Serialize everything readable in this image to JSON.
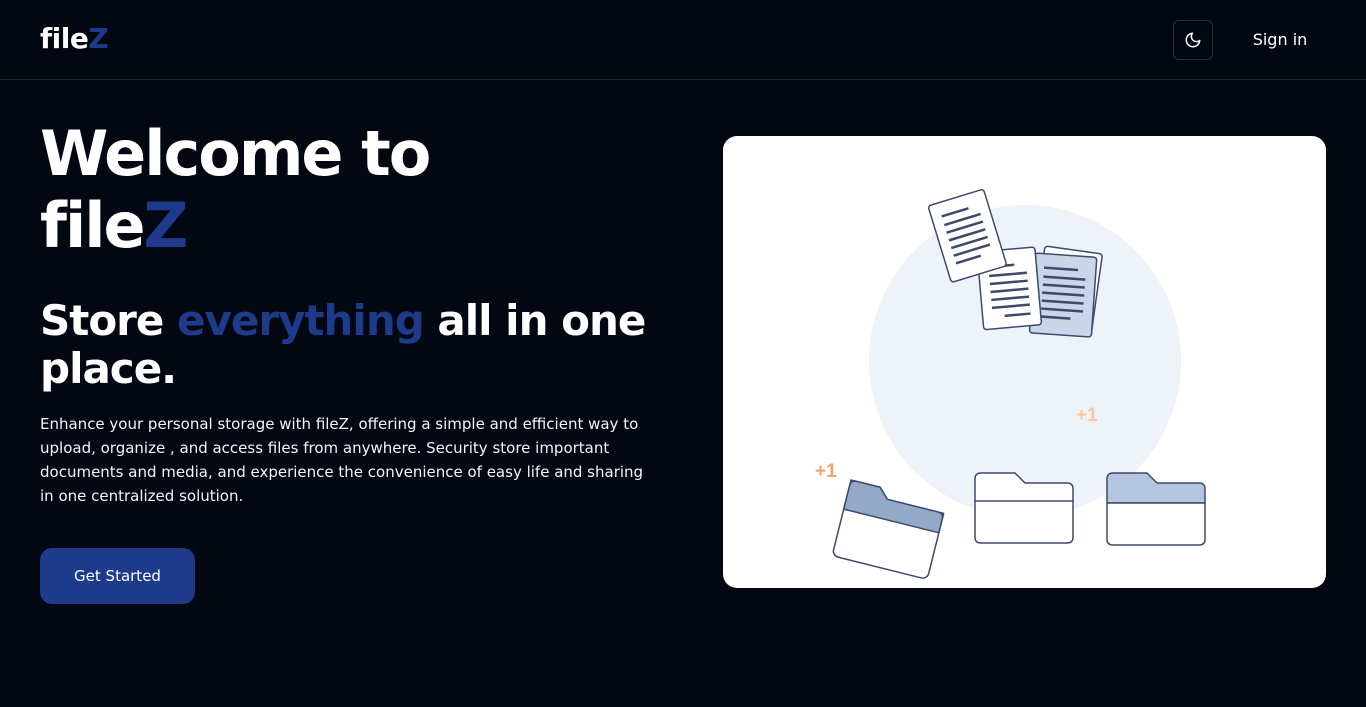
{
  "navbar": {
    "logo_main": "file",
    "logo_accent": "Z",
    "theme_toggle_icon": "moon-icon",
    "signin_label": "Sign in"
  },
  "hero": {
    "title_line1": "Welcome to",
    "title_main": "file",
    "title_accent": "Z",
    "subtitle_part1": "Store ",
    "subtitle_highlight": "everything",
    "subtitle_part2": " all in one place.",
    "description": "Enhance your personal storage with fileZ, offering a simple and efficient way to upload, organize , and access files from anywhere. Security store important documents and media, and experience the convenience of easy life and sharing in one centralized solution.",
    "cta_label": "Get Started"
  },
  "illustration": {
    "badge_left": "+1",
    "badge_right": "+1",
    "icons": [
      "documents-icon",
      "folder-icon"
    ]
  },
  "colors": {
    "background": "#030712",
    "accent": "#1e3a8a",
    "card": "#ffffff",
    "badge": "#f4a261"
  }
}
